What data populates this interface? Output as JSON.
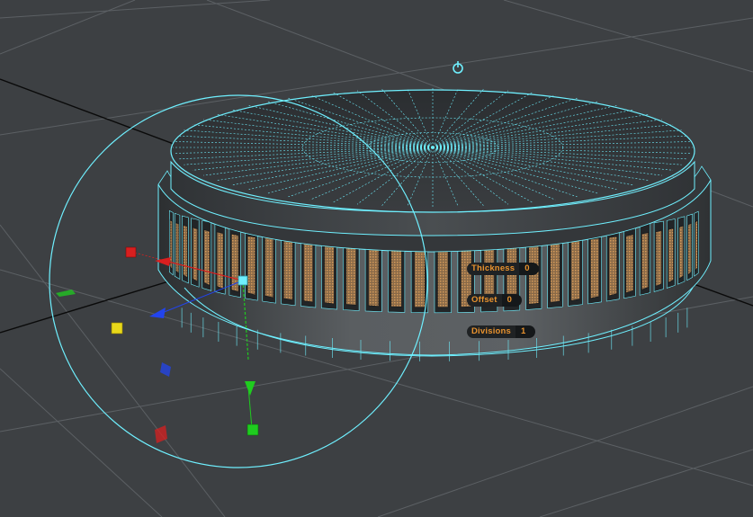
{
  "hud": {
    "thickness": {
      "label": "Thickness",
      "value": "0"
    },
    "offset": {
      "label": "Offset",
      "value": "0"
    },
    "divisions": {
      "label": "Divisions",
      "value": "1"
    }
  },
  "icons": {
    "pivot": "pivot-power-icon",
    "translate_x": "translate-x-cone-icon",
    "translate_y": "translate-y-cone-icon",
    "translate_z": "translate-z-cone-icon",
    "scale_x": "scale-x-cube-icon",
    "scale_y": "scale-y-cube-icon",
    "scale_z": "scale-z-cube-icon",
    "center": "manipulator-center-icon"
  },
  "colors": {
    "background": "#3d4043",
    "grid": "#5c6064",
    "axis": "#0a0a0a",
    "wire": "#6ff0ff",
    "mesh_dark": "#2a2d30",
    "mesh_mid": "#54585b",
    "face_fill": "#c9884a",
    "hud_text": "#e8922e",
    "x_axis": "#d81f1f",
    "y_axis": "#1fcc1f",
    "z_axis": "#2244ee",
    "yellow": "#e8d81a"
  }
}
